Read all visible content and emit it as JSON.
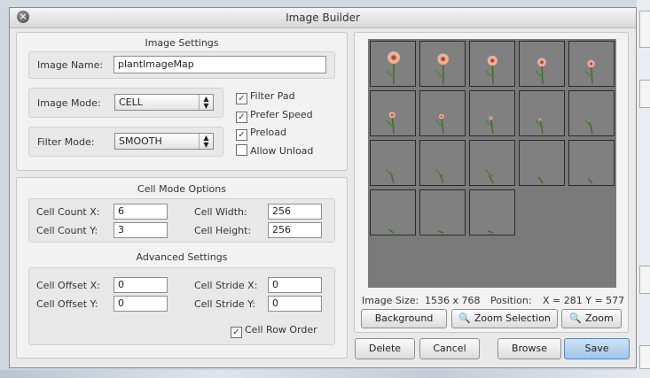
{
  "window": {
    "title": "Image Builder"
  },
  "image_settings": {
    "title": "Image Settings",
    "image_name_label": "Image Name:",
    "image_name_value": "plantImageMap",
    "image_mode_label": "Image Mode:",
    "image_mode_value": "CELL",
    "filter_mode_label": "Filter Mode:",
    "filter_mode_value": "SMOOTH",
    "checks": [
      {
        "label": "Filter Pad",
        "checked": true
      },
      {
        "label": "Prefer Speed",
        "checked": true
      },
      {
        "label": "Preload",
        "checked": true
      },
      {
        "label": "Allow Unload",
        "checked": false
      }
    ]
  },
  "cell_mode": {
    "title": "Cell Mode Options",
    "count_x_label": "Cell Count X:",
    "count_x_value": "6",
    "count_y_label": "Cell Count Y:",
    "count_y_value": "3",
    "width_label": "Cell Width:",
    "width_value": "256",
    "height_label": "Cell Height:",
    "height_value": "256"
  },
  "advanced": {
    "title": "Advanced Settings",
    "offset_x_label": "Cell Offset X:",
    "offset_x_value": "0",
    "offset_y_label": "Cell Offset Y:",
    "offset_y_value": "0",
    "stride_x_label": "Cell Stride X:",
    "stride_x_value": "0",
    "stride_y_label": "Cell Stride Y:",
    "stride_y_value": "0",
    "row_order_label": "Cell Row Order"
  },
  "preview": {
    "image_size_label": "Image Size:",
    "image_size_value": "1536 x 768",
    "position_label": "Position:",
    "position_value": "X = 281 Y = 577",
    "background_button": "Background",
    "zoom_selection_button": "Zoom Selection",
    "zoom_button": "Zoom",
    "cell_count": 18
  },
  "footer": {
    "delete_button": "Delete",
    "cancel_button": "Cancel",
    "browse_button": "Browse",
    "save_button": "Save"
  },
  "colors": {
    "accent": "#9fc5ea",
    "preview_bg": "#7a7a7a"
  }
}
